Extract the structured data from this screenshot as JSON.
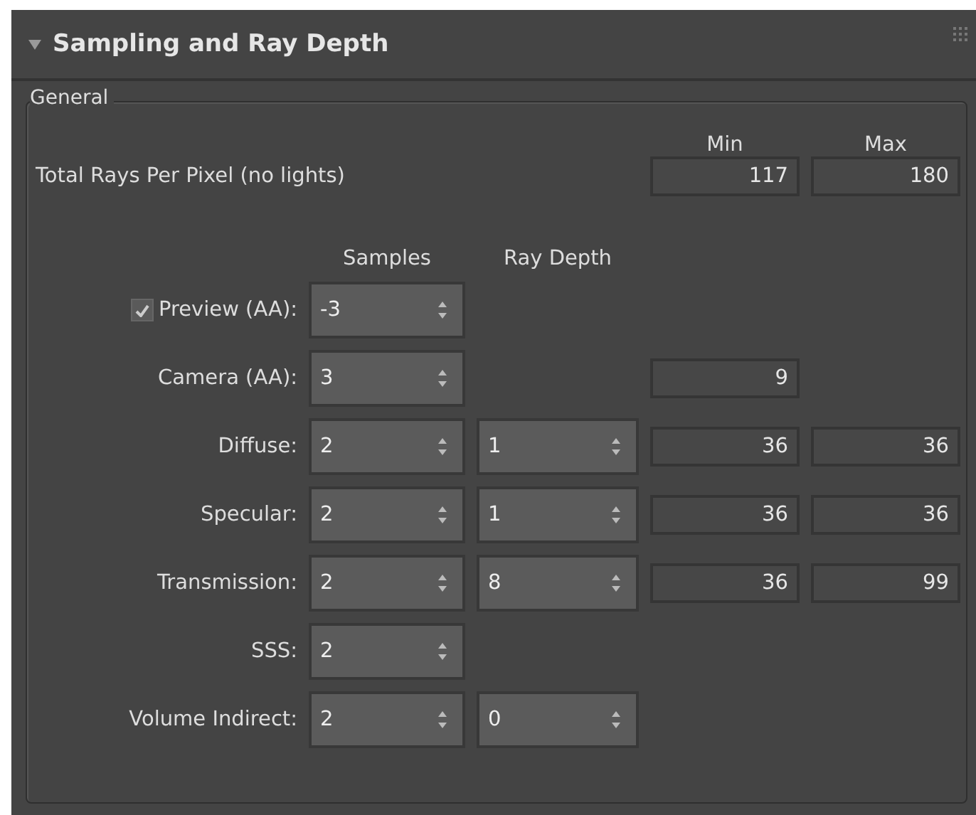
{
  "rollout": {
    "title": "Sampling and Ray Depth",
    "expanded": true
  },
  "group": {
    "title": "General",
    "min_header": "Min",
    "max_header": "Max",
    "total": {
      "label": "Total Rays Per Pixel (no lights)",
      "min": "117",
      "max": "180"
    },
    "samples_header": "Samples",
    "ray_depth_header": "Ray Depth",
    "rows": [
      {
        "label": "Preview (AA):",
        "checked": true,
        "samples": "-3"
      },
      {
        "label": "Camera (AA):",
        "samples": "3",
        "min": "9"
      },
      {
        "label": "Diffuse:",
        "samples": "2",
        "ray_depth": "1",
        "min": "36",
        "max": "36"
      },
      {
        "label": "Specular:",
        "samples": "2",
        "ray_depth": "1",
        "min": "36",
        "max": "36"
      },
      {
        "label": "Transmission:",
        "samples": "2",
        "ray_depth": "8",
        "min": "36",
        "max": "99"
      },
      {
        "label": "SSS:",
        "samples": "2"
      },
      {
        "label": "Volume Indirect:",
        "samples": "2",
        "ray_depth": "0"
      }
    ]
  }
}
